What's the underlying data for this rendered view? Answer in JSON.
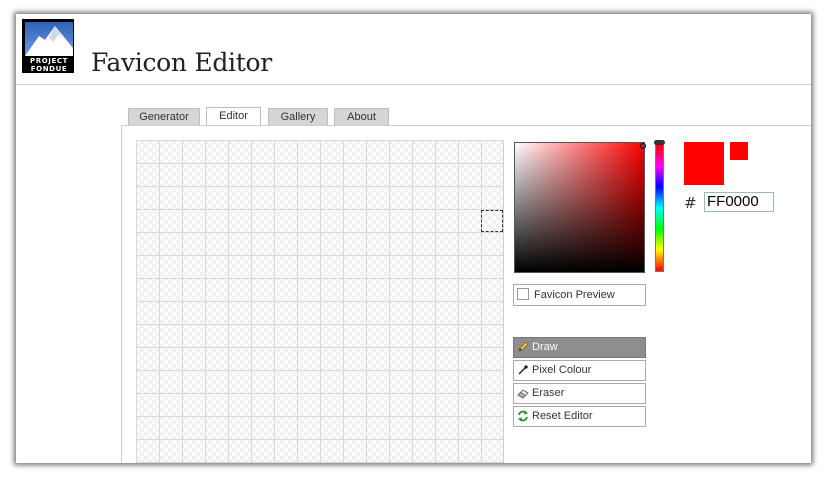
{
  "logo": {
    "line1": "PROJECT",
    "line2": "FONDUE"
  },
  "page": {
    "title": "Favicon Editor"
  },
  "tabs": [
    {
      "label": "Generator"
    },
    {
      "label": "Editor"
    },
    {
      "label": "Gallery"
    },
    {
      "label": "About"
    }
  ],
  "active_tab": "Editor",
  "color_picker": {
    "hex_symbol": "#",
    "hex_value": "FF0000",
    "current_color": "#ff0000"
  },
  "preview": {
    "label": "Favicon Preview"
  },
  "tools": {
    "draw": {
      "label": "Draw",
      "icon": "pencil-icon",
      "selected": true
    },
    "pixel_colour": {
      "label": "Pixel Colour",
      "icon": "eyedropper-icon"
    },
    "eraser": {
      "label": "Eraser",
      "icon": "eraser-icon"
    },
    "reset": {
      "label": "Reset Editor",
      "icon": "refresh-icon"
    }
  }
}
